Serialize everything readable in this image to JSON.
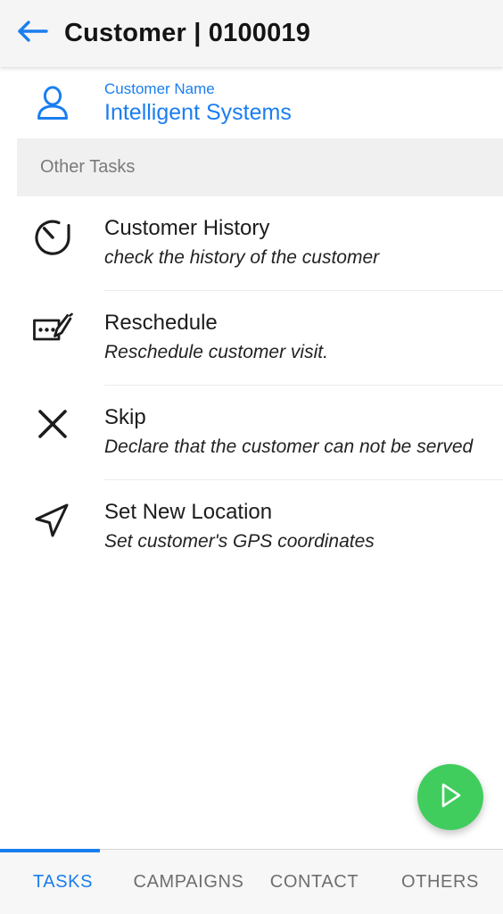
{
  "appbar": {
    "back_icon": "arrow-left-icon",
    "title": "Customer | 0100019",
    "accent_color": "#1a7ef0",
    "background_color": "#f5f5f5"
  },
  "customer": {
    "icon": "person-icon",
    "label": "Customer Name",
    "name": "Intelligent Systems",
    "color": "#1a7ef0"
  },
  "section": {
    "title": "Other Tasks",
    "background_color": "#f0f0f0"
  },
  "tasks": [
    {
      "icon": "history-clock-icon",
      "title": "Customer History",
      "description": "check the history of the customer"
    },
    {
      "icon": "reschedule-edit-icon",
      "title": "Reschedule",
      "description": "Reschedule customer visit."
    },
    {
      "icon": "close-x-icon",
      "title": "Skip",
      "description": "Declare that the customer can not be served"
    },
    {
      "icon": "navigation-arrow-icon",
      "title": "Set New Location",
      "description": "Set customer's GPS coordinates"
    }
  ],
  "fab": {
    "icon": "play-triangle-icon",
    "color": "#41cd5e"
  },
  "tabbar": {
    "active_index": 0,
    "active_color": "#1a7ef0",
    "inactive_color": "#6e6e6e",
    "tabs": [
      {
        "label": "TASKS"
      },
      {
        "label": "CAMPAIGNS"
      },
      {
        "label": "CONTACT"
      },
      {
        "label": "OTHERS"
      }
    ]
  }
}
